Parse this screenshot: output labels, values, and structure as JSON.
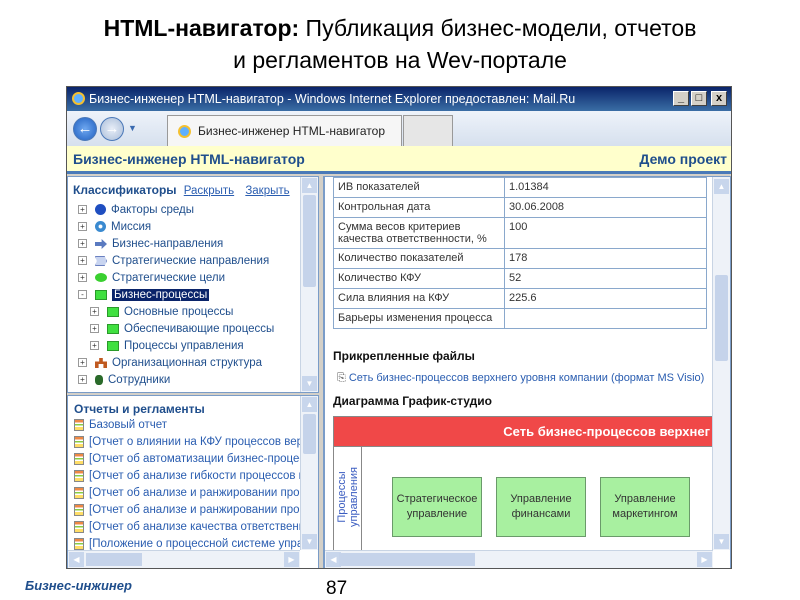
{
  "slide": {
    "title_bold": "HTML-навигатор:",
    "title_rest": " Публикация бизнес-модели, отчетов",
    "title_line2": "и регламентов на Wev-портале",
    "footer_left": "Бизнес-инжинер",
    "page_number": "87"
  },
  "browser": {
    "window_title": "Бизнес-инженер HTML-навигатор - Windows Internet Explorer предоставлен: Mail.Ru",
    "tab_label": "Бизнес-инженер HTML-навигатор",
    "minimize": "_",
    "maximize": "□",
    "close": "x"
  },
  "header": {
    "title": "Бизнес-инженер HTML-навигатор",
    "project": "Демо проект"
  },
  "classifiers": {
    "title": "Классификаторы",
    "expand": "Раскрыть",
    "collapse": "Закрыть",
    "items": [
      {
        "label": "Факторы среды",
        "icon": "factor-icon",
        "level": 0,
        "state": "+"
      },
      {
        "label": "Миссия",
        "icon": "mission-icon",
        "level": 0,
        "state": "+"
      },
      {
        "label": "Бизнес-направления",
        "icon": "arrow-icon",
        "level": 0,
        "state": "+"
      },
      {
        "label": "Стратегические направления",
        "icon": "strategy-direction-icon",
        "level": 0,
        "state": "+"
      },
      {
        "label": "Стратегические цели",
        "icon": "goal-icon",
        "level": 0,
        "state": "+"
      },
      {
        "label": "Бизнес-процессы",
        "icon": "process-icon",
        "level": 0,
        "state": "-",
        "selected": true
      },
      {
        "label": "Основные процессы",
        "icon": "process-icon",
        "level": 1,
        "state": "+"
      },
      {
        "label": "Обеспечивающие процессы",
        "icon": "process-icon",
        "level": 1,
        "state": "+"
      },
      {
        "label": "Процессы управления",
        "icon": "process-icon",
        "level": 1,
        "state": "+"
      },
      {
        "label": "Организационная структура",
        "icon": "org-structure-icon",
        "level": 0,
        "state": "+"
      },
      {
        "label": "Сотрудники",
        "icon": "employee-icon",
        "level": 0,
        "state": "+"
      }
    ]
  },
  "reports": {
    "title": "Отчеты и регламенты",
    "items": [
      "Базовый отчет",
      "[Отчет о влиянии на КФУ процессов вер",
      "[Отчет об автоматизации бизнес-процесс",
      "[Отчет об анализе гибкости процессов ве",
      "[Отчет об анализе и ранжировании проце",
      "[Отчет об анализе и ранжировании проце",
      "[Отчет об анализе качества ответственно",
      "[Положение о процессной системе управ"
    ]
  },
  "properties": [
    [
      "ИВ показателей",
      "1.01384"
    ],
    [
      "Контрольная дата",
      "30.06.2008"
    ],
    [
      "Сумма весов критериев качества ответственности, %",
      "100"
    ],
    [
      "Количество показателей",
      "178"
    ],
    [
      "Количество КФУ",
      "52"
    ],
    [
      "Сила влияния на КФУ",
      "225.6"
    ],
    [
      "Барьеры изменения процесса",
      ""
    ]
  ],
  "attached": {
    "title": "Прикрепленные файлы",
    "file": "Сеть бизнес-процессов верхнего уровня компании (формат  MS Visio)"
  },
  "diagram": {
    "title": "Диаграмма График-студио",
    "banner": "Сеть бизнес-процессов верхнег",
    "lane": "Процессы управления",
    "boxes": [
      "Стратегическое управление",
      "Управление финансами",
      "Управление маркетингом"
    ],
    "banner_color": "#f04848",
    "box_color": "#a8f0a0"
  }
}
